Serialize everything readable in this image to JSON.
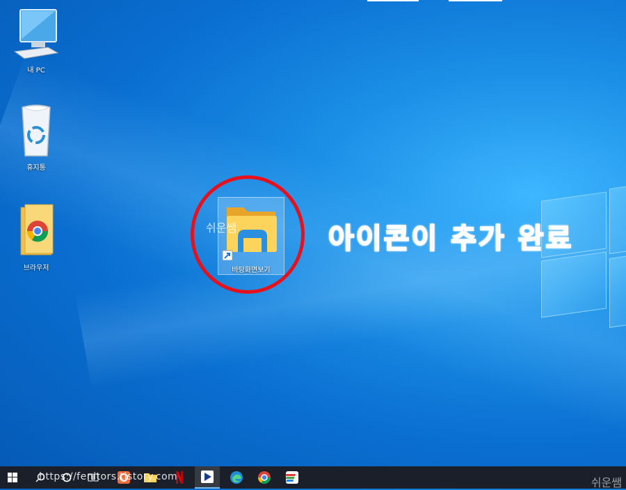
{
  "desktop": {
    "icons": [
      {
        "label": "내 PC",
        "icon": "computer-icon"
      },
      {
        "label": "휴지통",
        "icon": "recycle-bin-icon"
      },
      {
        "label": "브라우저",
        "icon": "chrome-folder-icon"
      }
    ],
    "new_icon": {
      "label": "바탕화면보기",
      "icon": "file-explorer-shortcut-icon"
    },
    "watermark": "쉬운쌤",
    "callout": "아이콘이 추가 완료"
  },
  "taskbar": {
    "items": [
      {
        "name": "start-button",
        "icon": "windows-logo-icon"
      },
      {
        "name": "search-button",
        "icon": "search-icon"
      },
      {
        "name": "cortana-button",
        "icon": "cortana-ring-icon"
      },
      {
        "name": "task-view-button",
        "icon": "task-view-icon"
      },
      {
        "name": "taskbar-app-orange",
        "icon": "camera-app-icon"
      },
      {
        "name": "taskbar-file-explorer",
        "icon": "folder-icon"
      },
      {
        "name": "taskbar-netflix",
        "icon": "netflix-icon"
      },
      {
        "name": "taskbar-media-player",
        "icon": "play-icon"
      },
      {
        "name": "taskbar-edge",
        "icon": "edge-icon"
      },
      {
        "name": "taskbar-chrome",
        "icon": "chrome-icon"
      },
      {
        "name": "taskbar-app-stripes",
        "icon": "stripes-app-icon"
      }
    ],
    "url_overlay": "https://fenitors.tistory.com",
    "watermark": "쉬운쌤"
  },
  "colors": {
    "accent_red": "#e8101a",
    "taskbar": "#1a1f29",
    "desktop_blue": "#0a6fd1"
  }
}
